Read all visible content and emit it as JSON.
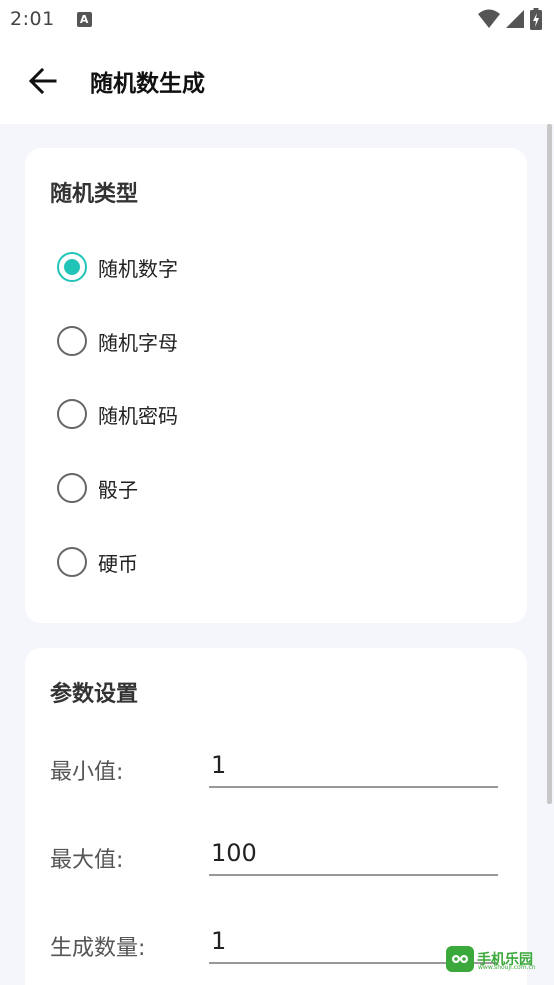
{
  "status_bar": {
    "time": "2:01",
    "notification_icon_letter": "A"
  },
  "app_bar": {
    "title": "随机数生成",
    "back_icon": "arrow-left-icon"
  },
  "random_type": {
    "title": "随机类型",
    "selected": "随机数字",
    "options": [
      {
        "label": "随机数字",
        "checked": true
      },
      {
        "label": "随机字母",
        "checked": false
      },
      {
        "label": "随机密码",
        "checked": false
      },
      {
        "label": "骰子",
        "checked": false
      },
      {
        "label": "硬币",
        "checked": false
      }
    ]
  },
  "params": {
    "title": "参数设置",
    "fields": [
      {
        "label": "最小值:",
        "value": "1"
      },
      {
        "label": "最大值:",
        "value": "100"
      },
      {
        "label": "生成数量:",
        "value": "1"
      }
    ]
  },
  "watermark": {
    "text": "手机乐园",
    "url": "www.shouji.com.cn"
  },
  "colors": {
    "accent": "#22c4b8",
    "background": "#f4f6fb",
    "card": "#ffffff",
    "watermark": "#3aa83a"
  }
}
